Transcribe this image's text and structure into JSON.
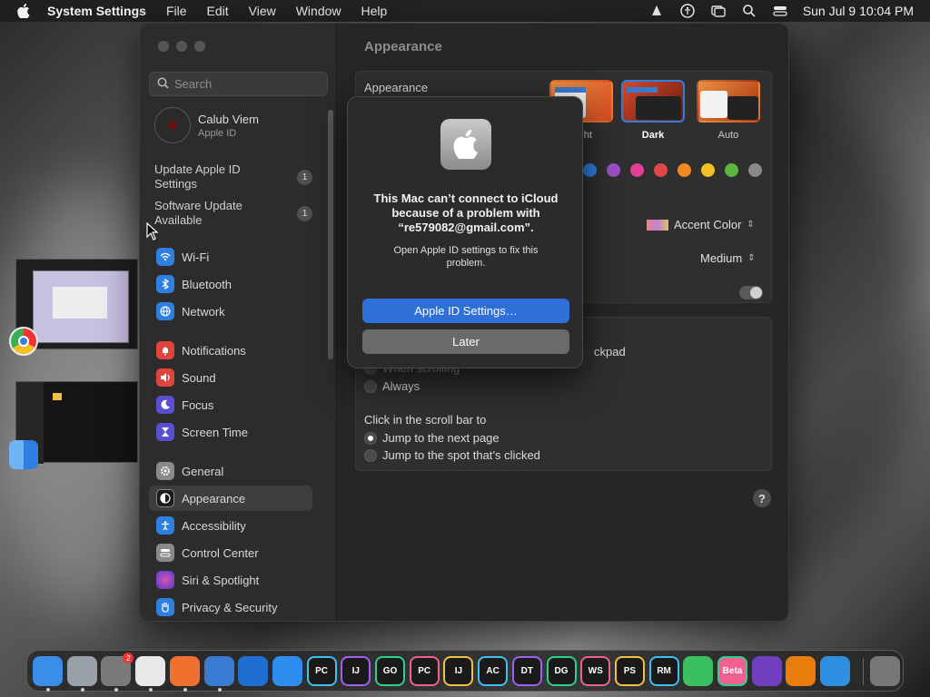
{
  "menubar": {
    "app_name": "System Settings",
    "menus": [
      "File",
      "Edit",
      "View",
      "Window",
      "Help"
    ],
    "clock": "Sun Jul 9  10:04 PM"
  },
  "sidebar": {
    "search_placeholder": "Search",
    "account": {
      "name": "Calub Viem",
      "subtitle": "Apple ID"
    },
    "notices": [
      {
        "label": "Update Apple ID Settings",
        "count": "1"
      },
      {
        "label": "Software Update Available",
        "count": "1"
      }
    ],
    "items": [
      {
        "label": "Wi-Fi",
        "icon": "wifi-icon",
        "color": "#2f7fe0"
      },
      {
        "label": "Bluetooth",
        "icon": "bluetooth-icon",
        "color": "#2f7fe0"
      },
      {
        "label": "Network",
        "icon": "globe-icon",
        "color": "#2f7fe0"
      },
      {
        "label": "Notifications",
        "icon": "bell-icon",
        "color": "#e0443e"
      },
      {
        "label": "Sound",
        "icon": "speaker-icon",
        "color": "#e0443e"
      },
      {
        "label": "Focus",
        "icon": "moon-icon",
        "color": "#5a4fd0"
      },
      {
        "label": "Screen Time",
        "icon": "hourglass-icon",
        "color": "#5a4fd0"
      },
      {
        "label": "General",
        "icon": "gear-icon",
        "color": "#8a8a8a"
      },
      {
        "label": "Appearance",
        "icon": "appearance-icon",
        "color": "#1c1c1c"
      },
      {
        "label": "Accessibility",
        "icon": "accessibility-icon",
        "color": "#2f7fe0"
      },
      {
        "label": "Control Center",
        "icon": "control-center-icon",
        "color": "#8a8a8a"
      },
      {
        "label": "Siri & Spotlight",
        "icon": "siri-icon",
        "color": "#c04ad0"
      },
      {
        "label": "Privacy & Security",
        "icon": "hand-icon",
        "color": "#2f7fe0"
      }
    ],
    "active": "Appearance"
  },
  "content": {
    "title": "Appearance",
    "appearance_label": "Appearance",
    "themes": [
      {
        "name": "Light"
      },
      {
        "name": "Dark",
        "selected": true
      },
      {
        "name": "Auto"
      }
    ],
    "accent_swatches": [
      "#2f7fe0",
      "#9b4fc6",
      "#e0409a",
      "#e04848",
      "#f08a24",
      "#f5c024",
      "#5cb840",
      "#8a8a8a"
    ],
    "accent_color_label": "Accent Color",
    "sidebar_icon_size": "Medium",
    "scroll_partial": "ckpad",
    "scroll_when": "When scrolling",
    "scroll_always": "Always",
    "click_scroll_label": "Click in the scroll bar to",
    "click_options": [
      {
        "label": "Jump to the next page",
        "selected": true
      },
      {
        "label": "Jump to the spot that’s clicked",
        "selected": false
      }
    ],
    "help": "?"
  },
  "alert": {
    "title": "This Mac can’t connect to iCloud because of a problem with “re579082@gmail.com”.",
    "message": "Open Apple ID settings to fix this problem.",
    "primary_button": "Apple ID Settings…",
    "secondary_button": "Later"
  },
  "dock": {
    "apps": [
      {
        "name": "finder-icon",
        "label": "",
        "color": "#3b8ee8"
      },
      {
        "name": "launchpad-icon",
        "label": "",
        "color": "#9aa0a8"
      },
      {
        "name": "system-settings-icon",
        "label": "",
        "color": "#7a7a7a",
        "badge": "2"
      },
      {
        "name": "chrome-icon",
        "label": "",
        "color": "#e8e8e8"
      },
      {
        "name": "firefox-icon",
        "label": "",
        "color": "#f07030"
      },
      {
        "name": "preview-icon",
        "label": "",
        "color": "#3a7ad0"
      },
      {
        "name": "vscode-icon",
        "label": "",
        "color": "#1f6fd0"
      },
      {
        "name": "app-store-icon",
        "label": "",
        "color": "#2e8ef0"
      },
      {
        "name": "pycharm-icon",
        "label": "PC",
        "color": "#1a1a1a"
      },
      {
        "name": "intellij-icon",
        "label": "IJ",
        "color": "#1a1a1a"
      },
      {
        "name": "goland-icon",
        "label": "GO",
        "color": "#1a1a1a"
      },
      {
        "name": "pycharm-ce-icon",
        "label": "PC",
        "color": "#1a1a1a"
      },
      {
        "name": "intellij-ce-icon",
        "label": "IJ",
        "color": "#1a1a1a"
      },
      {
        "name": "appcode-icon",
        "label": "AC",
        "color": "#1a1a1a"
      },
      {
        "name": "datagrip-icon",
        "label": "DT",
        "color": "#1a1a1a"
      },
      {
        "name": "dataspell-icon",
        "label": "DG",
        "color": "#1a1a1a"
      },
      {
        "name": "webstorm-icon",
        "label": "WS",
        "color": "#1a1a1a"
      },
      {
        "name": "phpstorm-icon",
        "label": "PS",
        "color": "#1a1a1a"
      },
      {
        "name": "rubymine-icon",
        "label": "RM",
        "color": "#1a1a1a"
      },
      {
        "name": "android-studio-icon",
        "label": "",
        "color": "#3ac060"
      },
      {
        "name": "jetbrains-beta-icon",
        "label": "Beta",
        "color": "#f06090"
      },
      {
        "name": "visual-studio-icon",
        "label": "",
        "color": "#7040c0"
      },
      {
        "name": "blender-icon",
        "label": "",
        "color": "#e87d0d"
      },
      {
        "name": "xcode-icon",
        "label": "",
        "color": "#2f8fe0"
      },
      {
        "name": "trash-icon",
        "label": "",
        "color": "#777"
      }
    ]
  }
}
